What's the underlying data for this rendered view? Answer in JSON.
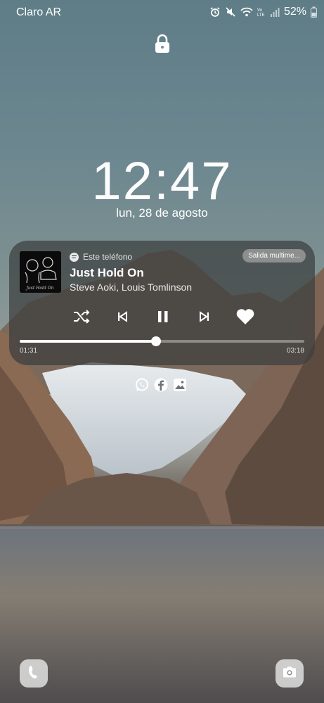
{
  "status_bar": {
    "carrier": "Claro AR",
    "battery": "52%",
    "icons": [
      "alarm-icon",
      "mute-icon",
      "wifi-icon",
      "volte-icon",
      "signal-icon",
      "battery-icon"
    ]
  },
  "lock_icon": "lock-icon",
  "clock": {
    "time": "12:47",
    "date": "lun, 28 de agosto"
  },
  "media": {
    "source": "Este teléfono",
    "output_button": "Salida multime...",
    "title": "Just Hold On",
    "artist": "Steve Aoki, Louis Tomlinson",
    "album_art_text": "Just Hold On",
    "elapsed": "01:31",
    "total": "03:18",
    "progress": 0.48,
    "controls": [
      "shuffle-icon",
      "previous-icon",
      "pause-icon",
      "next-icon",
      "heart-icon"
    ]
  },
  "app_shortcuts": [
    "whatsapp-icon",
    "facebook-icon",
    "gallery-icon"
  ],
  "bottom_shortcuts": {
    "left": "phone-icon",
    "right": "camera-icon"
  }
}
